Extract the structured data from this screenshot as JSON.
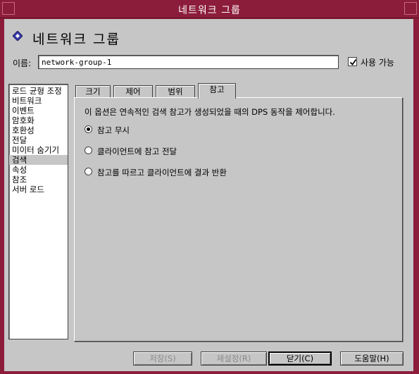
{
  "window": {
    "title": "네트워크 그룹"
  },
  "header": {
    "title": "네트워크 그룹",
    "icon": "diamond-icon"
  },
  "name_field": {
    "label": "이름:",
    "value": "network-group-1"
  },
  "enabled_checkbox": {
    "label": "사용 가능",
    "checked": true
  },
  "sidebar": {
    "items": [
      {
        "label": "로드 균형 조정"
      },
      {
        "label": "비트워크"
      },
      {
        "label": "이벤트"
      },
      {
        "label": "암호화"
      },
      {
        "label": "호환성"
      },
      {
        "label": "전달"
      },
      {
        "label": "미이터 숨기기"
      },
      {
        "label": "검색",
        "selected": true
      },
      {
        "label": "속성"
      },
      {
        "label": "참조"
      },
      {
        "label": "서버 로드"
      }
    ]
  },
  "tabs": [
    {
      "label": "크기"
    },
    {
      "label": "제어"
    },
    {
      "label": "범위"
    },
    {
      "label": "참고",
      "active": true
    }
  ],
  "panel": {
    "description": "이 옵션은 연속적인 검색 참고가 생성되었을 때의 DPS 동작을 제어합니다.",
    "options": [
      {
        "label": "참고 무시",
        "selected": true
      },
      {
        "label": "클라이언트에 참고 전달",
        "selected": false
      },
      {
        "label": "참고를 따르고 클라이언트에 결과 반환",
        "selected": false
      }
    ]
  },
  "buttons": {
    "save": "저장(S)",
    "reset": "재설정(R)",
    "close": "닫기(C)",
    "help": "도움말(H)"
  },
  "colors": {
    "titlebar": "#8c1d3a",
    "background": "#c6c6c6",
    "accent_icon": "#3a3aa8"
  }
}
